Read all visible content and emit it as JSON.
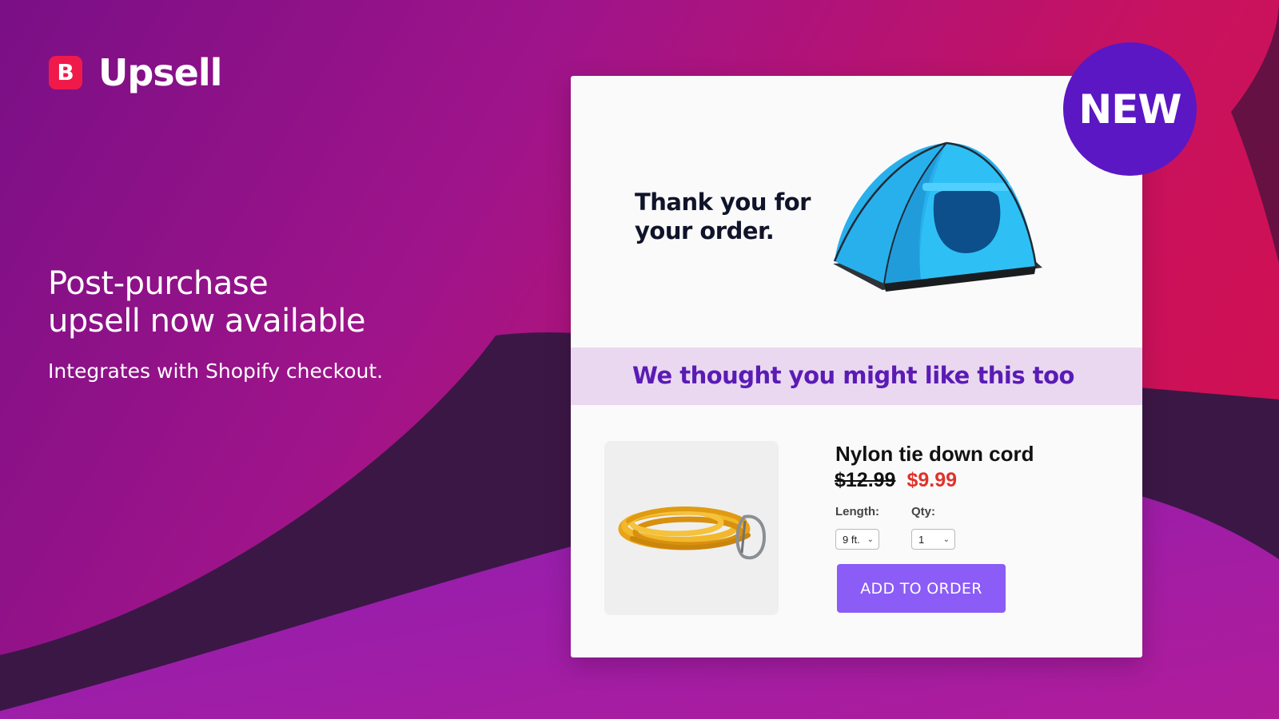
{
  "brand": {
    "logo_letter": "B",
    "name": "Upsell",
    "color": "#f01a4a"
  },
  "hero": {
    "title_line1": "Post-purchase",
    "title_line2": "upsell now available",
    "subtitle": "Integrates with Shopify checkout."
  },
  "badge": {
    "label": "NEW",
    "color": "#5b17c4"
  },
  "card": {
    "thanks_line1": "Thank you for",
    "thanks_line2": "your order.",
    "hero_image": "tent-image",
    "banner_text": "We thought you might like this too",
    "product": {
      "image": "rope-image",
      "name": "Nylon tie down cord",
      "price_original": "$12.99",
      "price_sale": "$9.99",
      "length_label": "Length:",
      "length_value": "9 ft.",
      "qty_label": "Qty:",
      "qty_value": "1",
      "button_label": "ADD TO ORDER"
    }
  },
  "colors": {
    "accent_purple": "#8b5cf6",
    "banner_text": "#5a1bb5",
    "banner_bg": "#ead8f0",
    "sale_price": "#e0322b"
  }
}
